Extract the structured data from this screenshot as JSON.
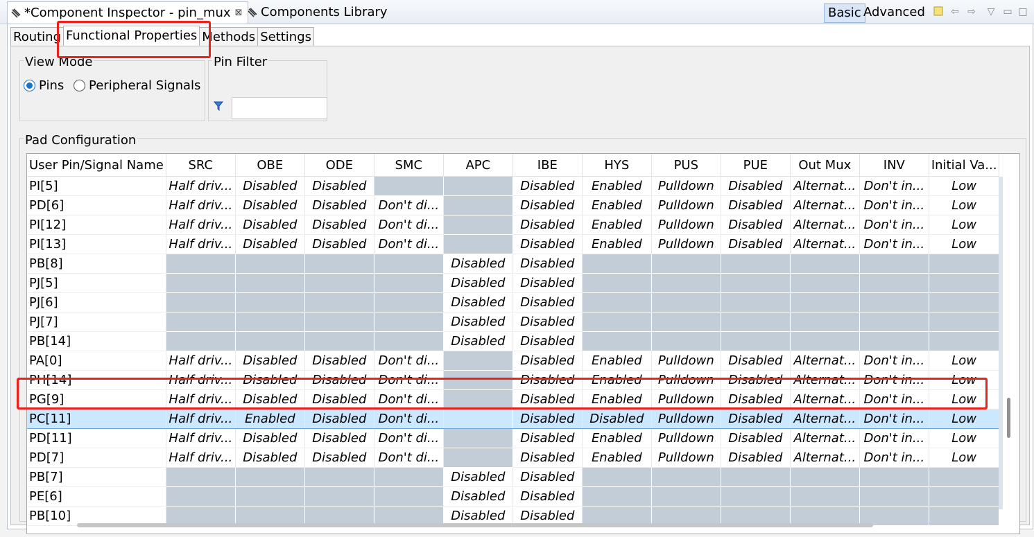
{
  "view_tabs": {
    "inspector": {
      "label": "*Component Inspector - pin_mux",
      "close": "⊠"
    },
    "library": {
      "label": "Components Library"
    }
  },
  "toolbar": {
    "basic": "Basic",
    "advanced": "Advanced"
  },
  "sub_tabs": [
    {
      "label": "Routing"
    },
    {
      "label": "Functional Properties"
    },
    {
      "label": "Methods"
    },
    {
      "label": "Settings"
    }
  ],
  "view_mode": {
    "legend": "View Mode",
    "options": [
      {
        "label": "Pins",
        "selected": true
      },
      {
        "label": "Peripheral Signals",
        "selected": false
      }
    ]
  },
  "pin_filter": {
    "legend": "Pin Filter",
    "value": ""
  },
  "pad_config": {
    "legend": "Pad Configuration"
  },
  "table": {
    "columns": [
      "User Pin/Signal Name",
      "SRC",
      "OBE",
      "ODE",
      "SMC",
      "APC",
      "IBE",
      "HYS",
      "PUS",
      "PUE",
      "Out Mux",
      "INV",
      "Initial Va..."
    ],
    "rows": [
      [
        "PI[5]",
        "Half driv...",
        "Disabled",
        "Disabled",
        null,
        null,
        "Disabled",
        "Enabled",
        "Pulldown",
        "Disabled",
        "Alternat...",
        "Don't in...",
        "Low"
      ],
      [
        "PD[6]",
        "Half driv...",
        "Disabled",
        "Disabled",
        "Don't di...",
        null,
        "Disabled",
        "Enabled",
        "Pulldown",
        "Disabled",
        "Alternat...",
        "Don't in...",
        "Low"
      ],
      [
        "PI[12]",
        "Half driv...",
        "Disabled",
        "Disabled",
        "Don't di...",
        null,
        "Disabled",
        "Enabled",
        "Pulldown",
        "Disabled",
        "Alternat...",
        "Don't in...",
        "Low"
      ],
      [
        "PI[13]",
        "Half driv...",
        "Disabled",
        "Disabled",
        "Don't di...",
        null,
        "Disabled",
        "Enabled",
        "Pulldown",
        "Disabled",
        "Alternat...",
        "Don't in...",
        "Low"
      ],
      [
        "PB[8]",
        null,
        null,
        null,
        null,
        "Disabled",
        "Disabled",
        null,
        null,
        null,
        null,
        null,
        null
      ],
      [
        "PJ[5]",
        null,
        null,
        null,
        null,
        "Disabled",
        "Disabled",
        null,
        null,
        null,
        null,
        null,
        null
      ],
      [
        "PJ[6]",
        null,
        null,
        null,
        null,
        "Disabled",
        "Disabled",
        null,
        null,
        null,
        null,
        null,
        null
      ],
      [
        "PJ[7]",
        null,
        null,
        null,
        null,
        "Disabled",
        "Disabled",
        null,
        null,
        null,
        null,
        null,
        null
      ],
      [
        "PB[14]",
        null,
        null,
        null,
        null,
        "Disabled",
        "Disabled",
        null,
        null,
        null,
        null,
        null,
        null
      ],
      [
        "PA[0]",
        "Half driv...",
        "Disabled",
        "Disabled",
        "Don't di...",
        null,
        "Disabled",
        "Enabled",
        "Pulldown",
        "Disabled",
        "Alternat...",
        "Don't in...",
        "Low"
      ],
      [
        "PH[14]",
        "Half driv...",
        "Disabled",
        "Disabled",
        "Don't di...",
        null,
        "Disabled",
        "Enabled",
        "Pulldown",
        "Disabled",
        "Alternat...",
        "Don't in...",
        "Low"
      ],
      [
        "PG[9]",
        "Half driv...",
        "Disabled",
        "Disabled",
        "Don't di...",
        null,
        "Disabled",
        "Enabled",
        "Pulldown",
        "Disabled",
        "Alternat...",
        "Don't in...",
        "Low"
      ],
      [
        "PC[11]",
        "Half driv...",
        "Enabled",
        "Disabled",
        "Don't di...",
        null,
        "Disabled",
        "Disabled",
        "Pulldown",
        "Disabled",
        "Alternat...",
        "Don't in...",
        "Low"
      ],
      [
        "PD[11]",
        "Half driv...",
        "Disabled",
        "Disabled",
        "Don't di...",
        null,
        "Disabled",
        "Enabled",
        "Pulldown",
        "Disabled",
        "Alternat...",
        "Don't in...",
        "Low"
      ],
      [
        "PD[7]",
        "Half driv...",
        "Disabled",
        "Disabled",
        "Don't di...",
        null,
        "Disabled",
        "Enabled",
        "Pulldown",
        "Disabled",
        "Alternat...",
        "Don't in...",
        "Low"
      ],
      [
        "PB[7]",
        null,
        null,
        null,
        null,
        "Disabled",
        "Disabled",
        null,
        null,
        null,
        null,
        null,
        null
      ],
      [
        "PE[6]",
        null,
        null,
        null,
        null,
        "Disabled",
        "Disabled",
        null,
        null,
        null,
        null,
        null,
        null
      ],
      [
        "PB[10]",
        null,
        null,
        null,
        null,
        "Disabled",
        "Disabled",
        null,
        null,
        null,
        null,
        null,
        null
      ]
    ],
    "selected_row": 12
  },
  "colors": {
    "accent": "#1a73c9",
    "highlight": "#e8231e",
    "na_cell": "#c3cdd8",
    "selection": "#cce8ff"
  }
}
